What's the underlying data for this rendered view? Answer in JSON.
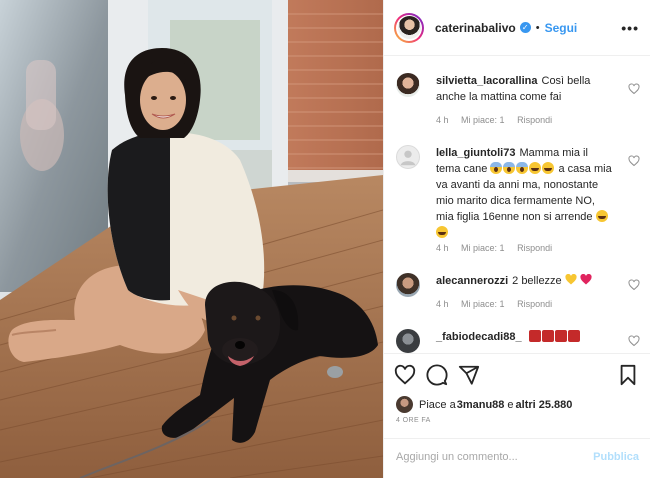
{
  "photo": {
    "alt": "caterinabalivo post photo"
  },
  "header": {
    "username": "caterinabalivo",
    "verified_mark": "✓",
    "separator": "•",
    "follow_label": "Segui",
    "more_label": "•••"
  },
  "comments": [
    {
      "user": "silvietta_lacorallina",
      "text": "Così bella anche la mattina come fai",
      "age": "4 h",
      "likes": "Mi piace: 1",
      "reply": "Rispondi"
    },
    {
      "user": "lella_giuntoli73",
      "text_a": "Mamma mia il tema cane",
      "text_b": "a casa mia va avanti da anni ma, nonostante mio marito dica fermamente NO, mia figlia 16enne non si arrende",
      "age": "4 h",
      "likes": "Mi piace: 1",
      "reply": "Rispondi"
    },
    {
      "user": "alecannerozzi",
      "text": "2 bellezze",
      "age": "4 h",
      "likes": "Mi piace: 1",
      "reply": "Rispondi"
    },
    {
      "user": "_fabiodecadi88_",
      "text": ""
    }
  ],
  "actions": {
    "likes_prefix": "Piace a ",
    "likes_user": "3manu88",
    "likes_mid": " e ",
    "likes_others": "altri 25.880",
    "timestamp": "4 ORE FA"
  },
  "add_comment": {
    "placeholder": "Aggiungi un commento...",
    "publish_label": "Pubblica"
  },
  "colors": {
    "accent": "#3897f0",
    "publish_disabled": "#b2dffc",
    "meta": "#8e8e8e"
  }
}
